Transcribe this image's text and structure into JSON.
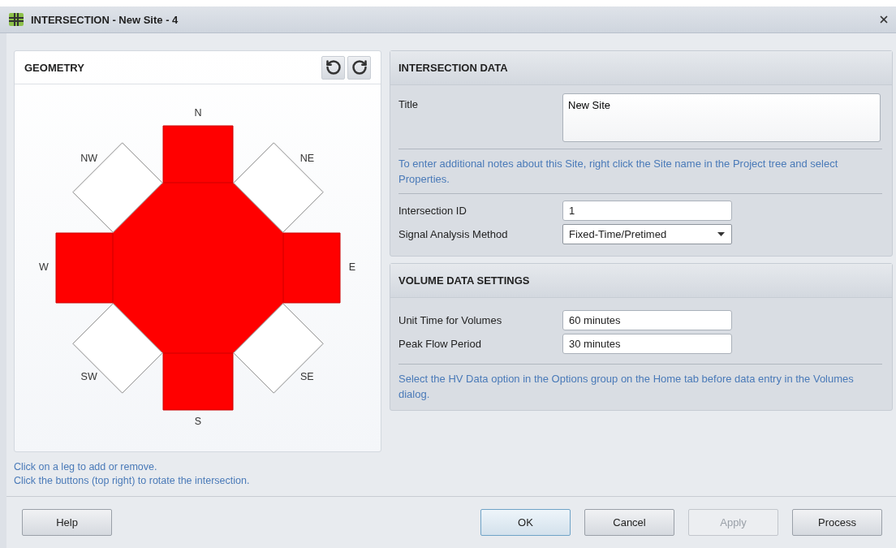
{
  "window": {
    "title": "INTERSECTION - New Site - 4"
  },
  "geometry": {
    "title": "GEOMETRY",
    "legs": [
      {
        "label": "N",
        "active": true
      },
      {
        "label": "NE",
        "active": false
      },
      {
        "label": "E",
        "active": true
      },
      {
        "label": "SE",
        "active": false
      },
      {
        "label": "S",
        "active": true
      },
      {
        "label": "SW",
        "active": false
      },
      {
        "label": "W",
        "active": true
      },
      {
        "label": "NW",
        "active": false
      }
    ],
    "notes": [
      "Click on a leg to add or remove.",
      "Click the buttons (top right) to rotate the intersection."
    ]
  },
  "intersection_data": {
    "title": "INTERSECTION DATA",
    "title_field": {
      "label": "Title",
      "value": "New Site"
    },
    "note": "To enter additional notes about this Site, right click the Site name in the Project tree and select Properties.",
    "fields": [
      {
        "label": "Intersection ID",
        "value": "1",
        "kind": "text"
      },
      {
        "label": "Signal Analysis Method",
        "value": "Fixed-Time/Pretimed",
        "kind": "select"
      }
    ]
  },
  "volume_data_settings": {
    "title": "VOLUME DATA SETTINGS",
    "fields": [
      {
        "label": "Unit Time for Volumes",
        "value": "60 minutes",
        "kind": "text"
      },
      {
        "label": "Peak Flow Period",
        "value": "30 minutes",
        "kind": "text"
      }
    ],
    "note": "Select the HV Data option in the Options group on the Home tab before data entry in the Volumes dialog."
  },
  "buttons": [
    {
      "label": "Help",
      "default": false,
      "disabled": false
    },
    {
      "label": "OK",
      "default": true,
      "disabled": false
    },
    {
      "label": "Cancel",
      "default": false,
      "disabled": false
    },
    {
      "label": "Apply",
      "default": false,
      "disabled": true
    },
    {
      "label": "Process",
      "default": false,
      "disabled": false
    }
  ]
}
